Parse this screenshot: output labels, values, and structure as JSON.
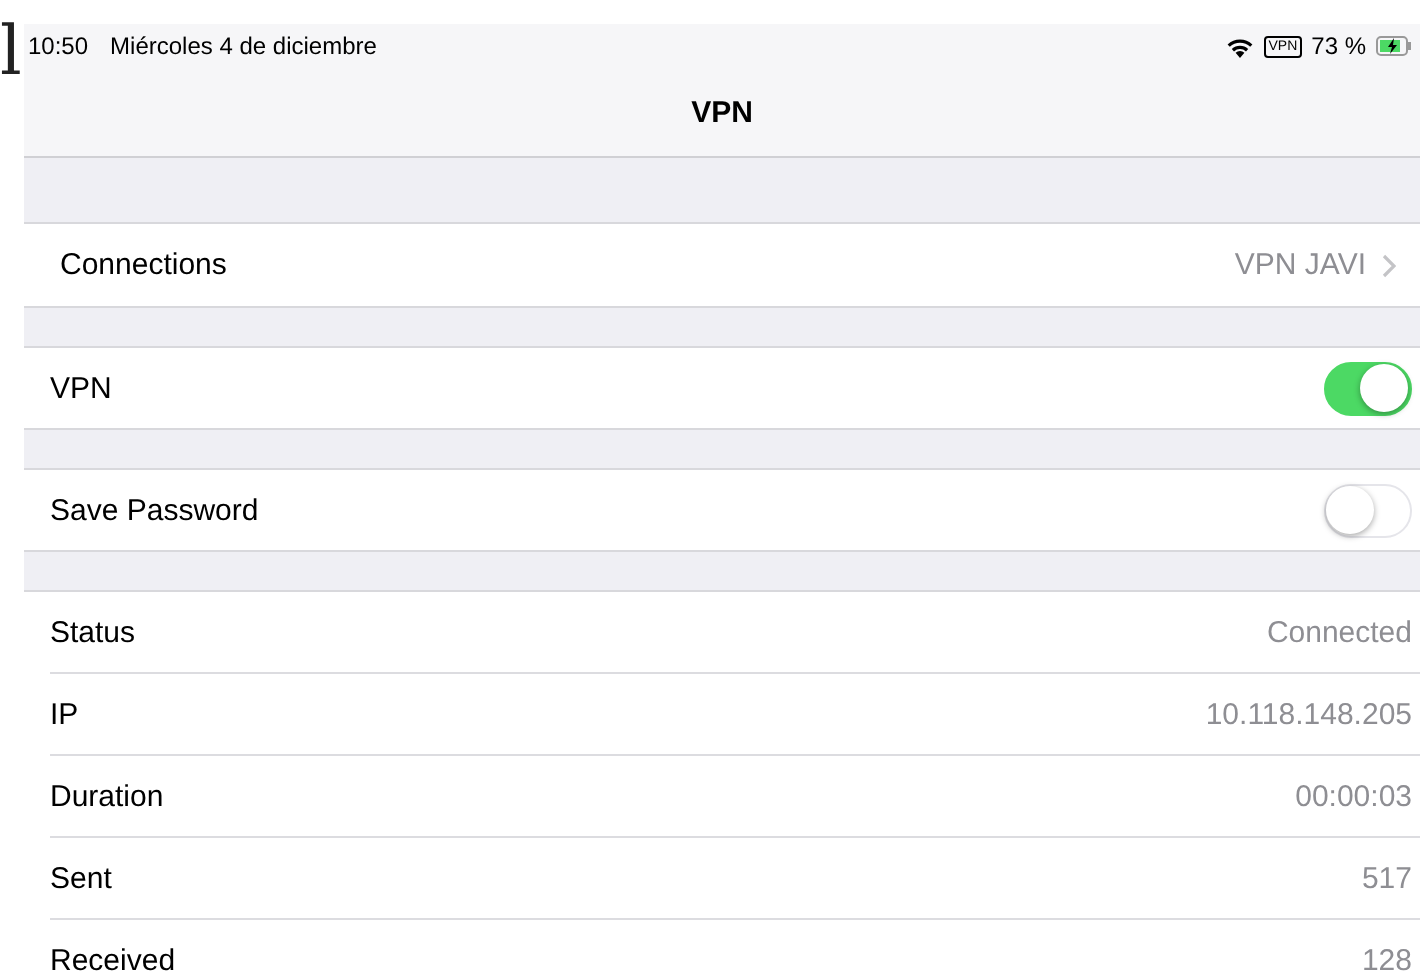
{
  "background_article": {
    "fragments": [
      "l"
    ]
  },
  "status_bar": {
    "time": "10:50",
    "date": "Miércoles 4 de diciembre",
    "vpn_badge": "VPN",
    "battery": "73 %"
  },
  "nav_bar": {
    "title": "VPN"
  },
  "sections": [
    {
      "rows": [
        {
          "kind": "link",
          "label": "Connections",
          "value": "VPN JAVI"
        }
      ]
    },
    {
      "rows": [
        {
          "kind": "toggle",
          "label": "VPN",
          "on": true
        }
      ]
    },
    {
      "rows": [
        {
          "kind": "toggle",
          "label": "Save Password",
          "on": false
        }
      ]
    },
    {
      "rows": [
        {
          "kind": "info",
          "label": "Status",
          "value": "Connected"
        },
        {
          "kind": "info",
          "label": "IP",
          "value": "10.118.148.205"
        },
        {
          "kind": "info",
          "label": "Duration",
          "value": "00:00:03"
        },
        {
          "kind": "info",
          "label": "Sent",
          "value": "517"
        },
        {
          "kind": "info",
          "label": "Received",
          "value": "128"
        }
      ]
    }
  ]
}
